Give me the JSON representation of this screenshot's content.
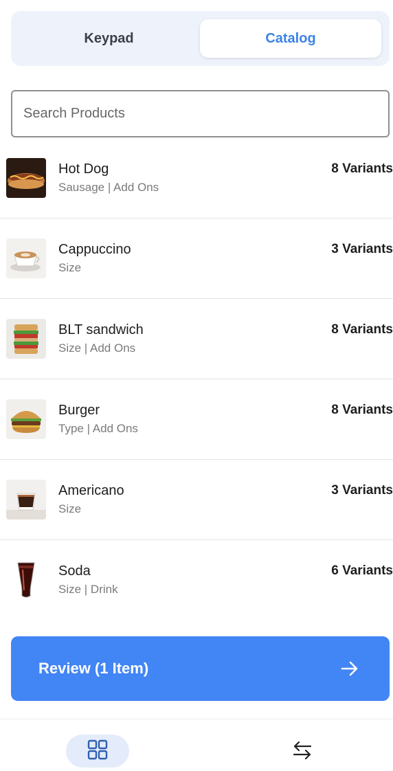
{
  "tabs": {
    "keypad": "Keypad",
    "catalog": "Catalog",
    "active": "Catalog"
  },
  "search": {
    "placeholder": "Search Products",
    "value": ""
  },
  "products": [
    {
      "name": "Hot Dog",
      "desc": "Sausage | Add Ons",
      "variants": "8 Variants",
      "icon": "hot-dog-image"
    },
    {
      "name": "Cappuccino",
      "desc": "Size",
      "variants": "3 Variants",
      "icon": "cappuccino-image"
    },
    {
      "name": "BLT sandwich",
      "desc": "Size | Add Ons",
      "variants": "8 Variants",
      "icon": "sandwich-image"
    },
    {
      "name": "Burger",
      "desc": "Type | Add Ons",
      "variants": "8 Variants",
      "icon": "burger-image"
    },
    {
      "name": "Americano",
      "desc": "Size",
      "variants": "3 Variants",
      "icon": "americano-image"
    },
    {
      "name": "Soda",
      "desc": "Size | Drink",
      "variants": "6 Variants",
      "icon": "soda-image"
    }
  ],
  "review": {
    "label": "Review (1 Item)",
    "icon": "arrow-right-icon"
  },
  "bottom_nav": {
    "grid_icon": "grid-icon",
    "swap_icon": "swap-arrows-icon"
  },
  "colors": {
    "accent": "#4285f4",
    "tab_active_text": "#3b82e6",
    "segment_bg": "#eef3fb"
  }
}
